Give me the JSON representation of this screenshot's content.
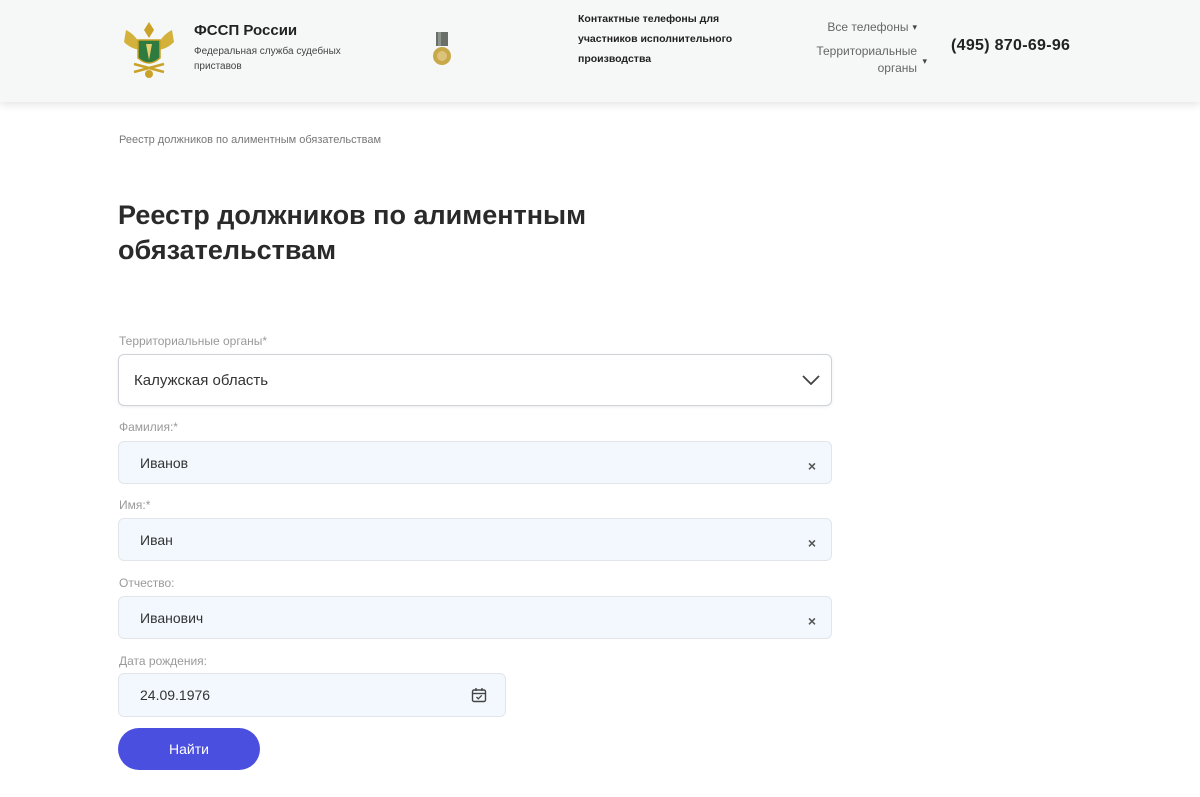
{
  "header": {
    "brand_title": "ФССП России",
    "brand_subtitle": "Федеральная служба судебных приставов",
    "contacts_title": "Контактные телефоны для участников исполнительного производства",
    "all_phones_label": "Все телефоны",
    "territorial_label": "Территориальные органы",
    "phone": "(495) 870-69-96"
  },
  "breadcrumb": "Реестр должников по алиментным обязательствам",
  "page_title": "Реестр должников по алиментным обязательствам",
  "form": {
    "territorial": {
      "label": "Территориальные органы*",
      "value": "Калужская область"
    },
    "surname": {
      "label": "Фамилия:*",
      "value": "Иванов"
    },
    "name": {
      "label": "Имя:*",
      "value": "Иван"
    },
    "patronymic": {
      "label": "Отчество:",
      "value": "Иванович"
    },
    "birthdate": {
      "label": "Дата рождения:",
      "value": "24.09.1976"
    },
    "submit_label": "Найти"
  },
  "colors": {
    "accent": "#4a4fe0",
    "field_bg": "#f2f8fd",
    "header_bg": "#f6f7f7"
  },
  "icons": {
    "emblem": "fssp-emblem-icon",
    "medal": "medal-icon",
    "select_chevron": "chevron-down-icon",
    "clear": "clear-icon",
    "calendar": "calendar-icon"
  }
}
